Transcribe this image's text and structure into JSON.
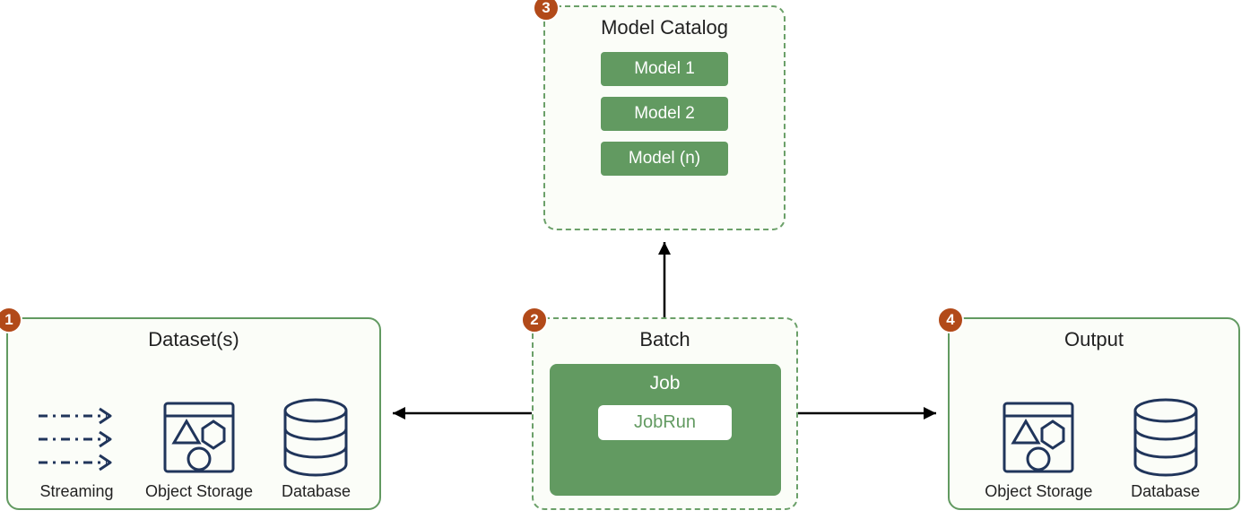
{
  "boxes": {
    "datasets": {
      "badge": "1",
      "title": "Dataset(s)",
      "items": {
        "streaming": "Streaming",
        "object_storage": "Object Storage",
        "database": "Database"
      }
    },
    "batch": {
      "badge": "2",
      "title": "Batch",
      "job_label": "Job",
      "jobrun_label": "JobRun"
    },
    "catalog": {
      "badge": "3",
      "title": "Model Catalog",
      "models": [
        "Model 1",
        "Model 2",
        "Model (n)"
      ]
    },
    "output": {
      "badge": "4",
      "title": "Output",
      "items": {
        "object_storage": "Object Storage",
        "database": "Database"
      }
    }
  }
}
